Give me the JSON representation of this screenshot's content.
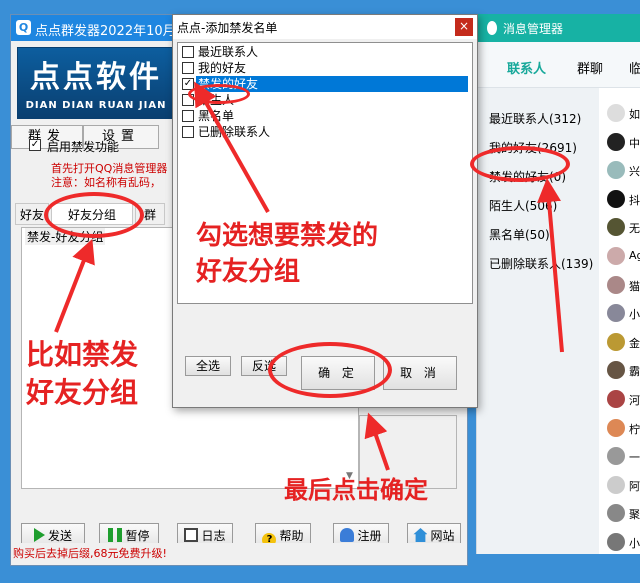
{
  "main_window": {
    "title": "点点群发器2022年10月0",
    "logo_big": "点点软件",
    "logo_small": "DIAN DIAN RUAN JIAN",
    "tabs": [
      "群发",
      "设置"
    ],
    "enable_label": "启用禁发功能",
    "note_line1": "首先打开QQ消息管理器",
    "note_line2": "注意：如名称有乱码，",
    "subtabs": [
      "好友",
      "好友分组",
      "群"
    ],
    "group_caption": "禁发-好友分组",
    "buttons": {
      "send": "发送",
      "pause": "暂停",
      "log": "日志",
      "help": "帮助",
      "register": "注册",
      "website": "网站"
    },
    "status": "购买后去掉后缀,68元免费升级!"
  },
  "dialog": {
    "title": "点点-添加禁发名单",
    "close": "×",
    "items": [
      {
        "label": "最近联系人",
        "checked": false
      },
      {
        "label": "我的好友",
        "checked": false
      },
      {
        "label": "禁发的好友",
        "checked": true
      },
      {
        "label": "陌生人",
        "checked": false
      },
      {
        "label": "黑名单",
        "checked": false
      },
      {
        "label": "已删除联系人",
        "checked": false
      }
    ],
    "select_all": "全选",
    "invert": "反选",
    "ok": "确 定",
    "cancel": "取 消"
  },
  "msg_manager": {
    "title": "消息管理器",
    "tabs": [
      "联系人",
      "群聊",
      "临"
    ],
    "groups": [
      "最近联系人(312)",
      "我的好友(2691)",
      "禁发的好友(0)",
      "陌生人(506)",
      "黑名单(50)",
      "已删除联系人(139)"
    ],
    "friends": [
      "如",
      "中",
      "兴",
      "抖",
      "无",
      "Ag",
      "猫",
      "小",
      "金",
      "霸",
      "河",
      "柠",
      "一",
      "阿",
      "聚",
      "小"
    ]
  },
  "annotations": {
    "check_group": [
      "勾选想要禁发的",
      "好友分组"
    ],
    "example": [
      "比如禁发",
      "好友分组"
    ],
    "confirm": "最后点击确定"
  },
  "colors": {
    "accent_blue": "#1f86e0",
    "qq_teal": "#17b2a4",
    "annotation_red": "#e52222"
  }
}
